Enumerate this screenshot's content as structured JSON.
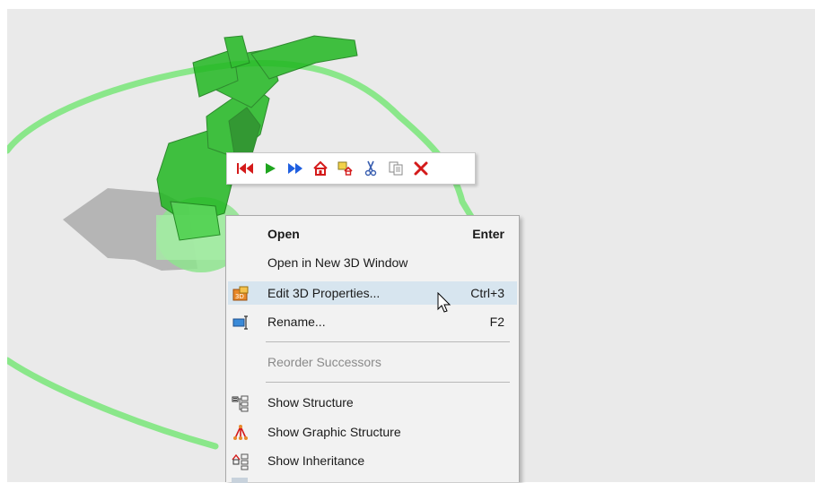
{
  "viewport": {
    "background": "#eaeaea",
    "robot_color": "#22b822",
    "ring_color": "#7fe77f"
  },
  "toolbar": {
    "buttons": [
      {
        "icon": "skip-to-start-icon"
      },
      {
        "icon": "play-icon"
      },
      {
        "icon": "fast-forward-icon"
      },
      {
        "icon": "home-icon"
      },
      {
        "icon": "set-home-icon"
      },
      {
        "icon": "cut-icon"
      },
      {
        "icon": "copy-icon"
      },
      {
        "icon": "delete-icon"
      }
    ]
  },
  "context_menu": {
    "items": [
      {
        "label": "Open",
        "shortcut": "Enter",
        "bold": true
      },
      {
        "label": "Open in New 3D Window",
        "shortcut": ""
      },
      {
        "label": "Edit 3D Properties...",
        "shortcut": "Ctrl+3",
        "icon": "edit-3d-properties-icon",
        "highlighted": true
      },
      {
        "label": "Rename...",
        "shortcut": "F2",
        "icon": "rename-icon"
      },
      {
        "label": "Reorder Successors",
        "shortcut": "",
        "disabled": true
      },
      {
        "label": "Show Structure",
        "shortcut": "",
        "icon": "show-structure-icon"
      },
      {
        "label": "Show Graphic Structure",
        "shortcut": "",
        "icon": "show-graphic-structure-icon"
      },
      {
        "label": "Show Inheritance",
        "shortcut": "",
        "icon": "show-inheritance-icon"
      }
    ]
  }
}
